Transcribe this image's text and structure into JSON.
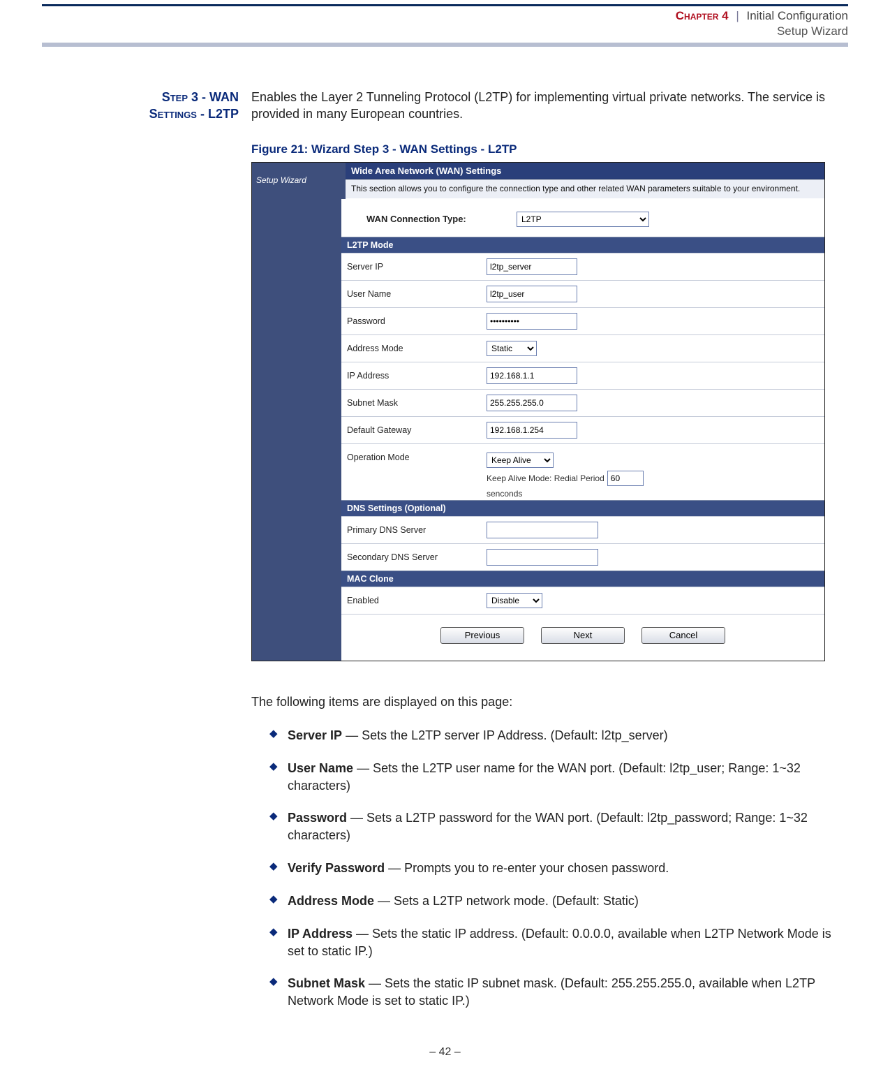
{
  "header": {
    "chapter_label": "Chapter 4",
    "separator": "|",
    "title": "Initial Configuration",
    "subtitle": "Setup Wizard"
  },
  "margin_heading_line1": "Step 3 - WAN",
  "margin_heading_line2": "Settings - L2TP",
  "intro_para": "Enables the Layer 2 Tunneling Protocol (L2TP) for implementing virtual private networks. The service is provided in many European countries.",
  "figure_caption": "Figure 21:  Wizard Step 3 - WAN Settings - L2TP",
  "screenshot": {
    "left_nav": "Setup Wizard",
    "main_header": "Wide Area Network (WAN) Settings",
    "main_desc": "This section allows you to configure the connection type and other related WAN parameters suitable to your environment.",
    "conn_label": "WAN Connection Type:",
    "conn_value": "L2TP",
    "sections": {
      "l2tp_mode": "L2TP Mode",
      "dns": "DNS Settings (Optional)",
      "mac": "MAC Clone"
    },
    "fields": {
      "server_ip": {
        "label": "Server IP",
        "value": "l2tp_server"
      },
      "user_name": {
        "label": "User Name",
        "value": "l2tp_user"
      },
      "password": {
        "label": "Password",
        "value": "••••••••••"
      },
      "addr_mode": {
        "label": "Address Mode",
        "value": "Static"
      },
      "ip_addr": {
        "label": "IP Address",
        "value": "192.168.1.1"
      },
      "subnet": {
        "label": "Subnet Mask",
        "value": "255.255.255.0"
      },
      "gateway": {
        "label": "Default Gateway",
        "value": "192.168.1.254"
      },
      "op_mode": {
        "label": "Operation Mode",
        "value": "Keep Alive",
        "redial_prefix": "Keep Alive Mode: Redial Period",
        "redial_value": "60",
        "redial_suffix": "senconds"
      },
      "dns1": {
        "label": "Primary DNS Server",
        "value": ""
      },
      "dns2": {
        "label": "Secondary DNS Server",
        "value": ""
      },
      "mac_enabled": {
        "label": "Enabled",
        "value": "Disable"
      }
    },
    "buttons": {
      "prev": "Previous",
      "next": "Next",
      "cancel": "Cancel"
    }
  },
  "below_para": "The following items are displayed on this page:",
  "bullets": [
    {
      "term": "Server IP",
      "rest": " — Sets the L2TP server IP Address. (Default: l2tp_server)"
    },
    {
      "term": "User Name",
      "rest": " — Sets the L2TP user name for the WAN port. (Default: l2tp_user; Range: 1~32 characters)"
    },
    {
      "term": "Password",
      "rest": " — Sets a L2TP password for the WAN port. (Default: l2tp_password; Range: 1~32 characters)"
    },
    {
      "term": "Verify Password",
      "rest": " — Prompts you to re-enter your chosen password."
    },
    {
      "term": "Address Mode",
      "rest": " — Sets a L2TP network mode. (Default: Static)"
    },
    {
      "term": "IP Address",
      "rest": " — Sets the static IP address. (Default: 0.0.0.0, available when L2TP Network Mode is set to static IP.)"
    },
    {
      "term": "Subnet Mask",
      "rest": " — Sets the static IP subnet mask. (Default: 255.255.255.0, available when L2TP Network Mode is set to static IP.)"
    }
  ],
  "page_number": "–  42  –"
}
